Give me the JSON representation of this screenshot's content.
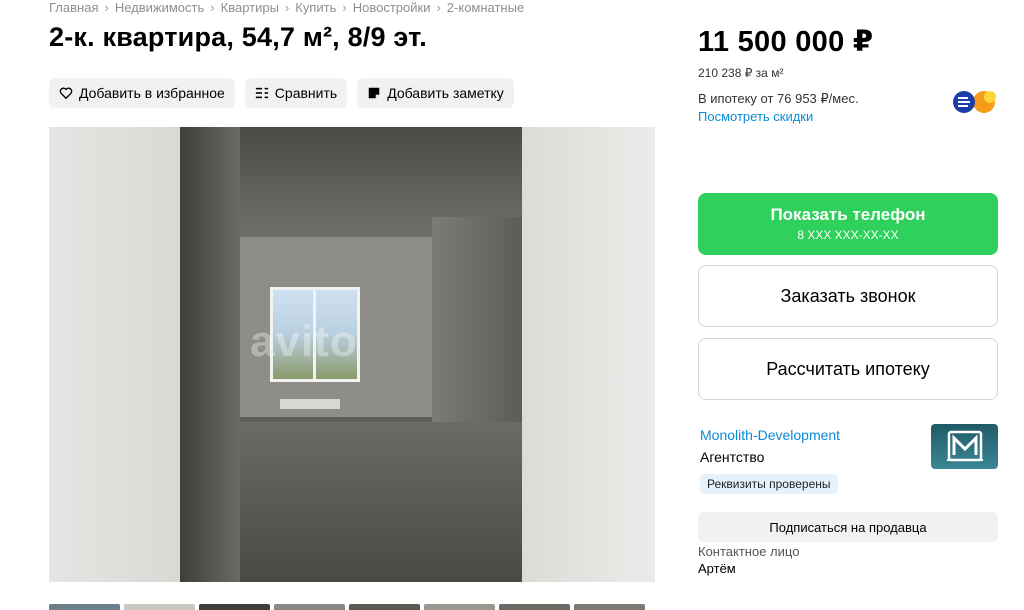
{
  "breadcrumbs": [
    "Главная",
    "Недвижимость",
    "Квартиры",
    "Купить",
    "Новостройки",
    "2-комнатные"
  ],
  "breadcrumb_separator": "›",
  "title": "2-к. квартира, 54,7 м², 8/9 эт.",
  "actions": {
    "favorite": "Добавить в избранное",
    "compare": "Сравнить",
    "note": "Добавить заметку"
  },
  "gallery": {
    "watermark": "avito",
    "thumbnail_count": 8
  },
  "price": {
    "total": "11 500 000 ₽",
    "per_meter": "210 238 ₽ за м²",
    "mortgage": "В ипотеку от 76 953 ₽/мес.",
    "discounts_link": "Посмотреть скидки"
  },
  "buttons": {
    "show_phone": "Показать телефон",
    "phone_mask": "8 XXX XXX-XX-XX",
    "request_call": "Заказать звонок",
    "calc_mortgage": "Рассчитать ипотеку",
    "subscribe": "Подписаться на продавца"
  },
  "seller": {
    "name": "Monolith-Development",
    "type": "Агентство",
    "verified_badge": "Реквизиты проверены",
    "contact_label": "Контактное лицо",
    "contact_name": "Артём"
  },
  "colors": {
    "primary_green": "#2fd05c",
    "link_blue": "#0a8ad6",
    "chip_bg": "#f2f1f0"
  }
}
